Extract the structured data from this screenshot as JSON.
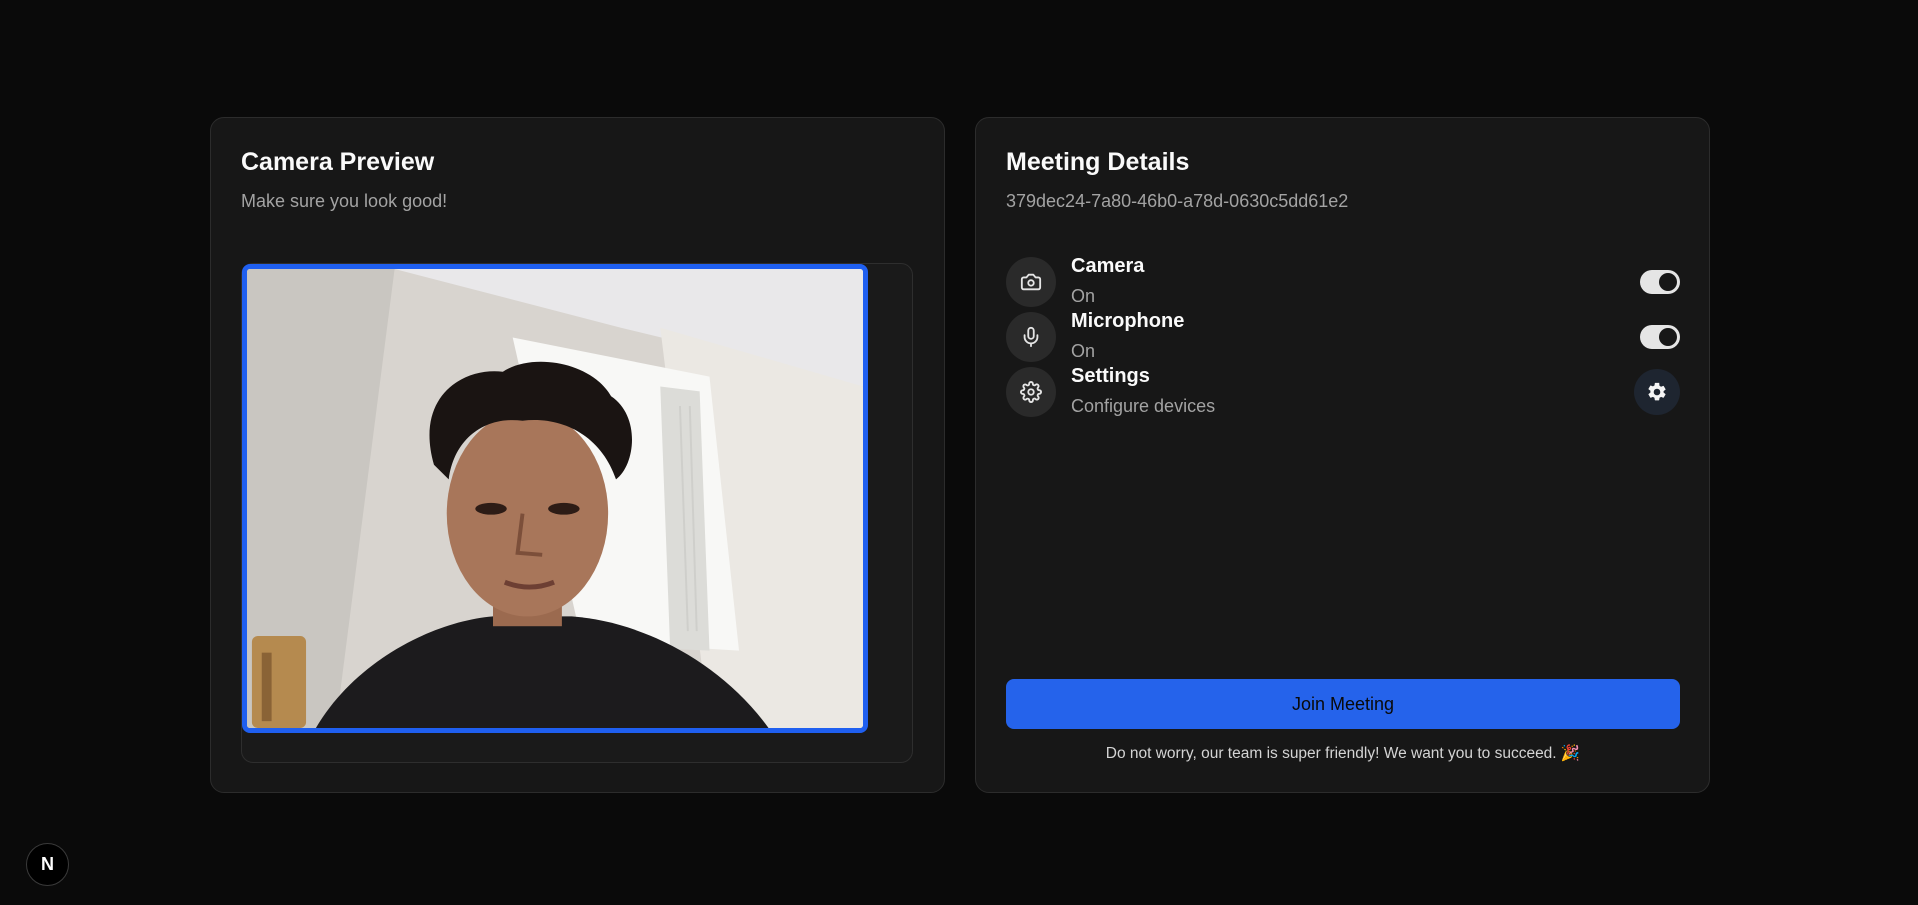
{
  "camera_preview": {
    "title": "Camera Preview",
    "subtitle": "Make sure you look good!"
  },
  "meeting_details": {
    "title": "Meeting Details",
    "meeting_id": "379dec24-7a80-46b0-a78d-0630c5dd61e2",
    "devices": [
      {
        "name": "Camera",
        "status": "On",
        "icon": "camera-icon",
        "control": "toggle",
        "enabled": true
      },
      {
        "name": "Microphone",
        "status": "On",
        "icon": "microphone-icon",
        "control": "toggle",
        "enabled": true
      },
      {
        "name": "Settings",
        "status": "Configure devices",
        "icon": "gear-icon",
        "control": "button"
      }
    ],
    "join_label": "Join Meeting",
    "footnote": "Do not worry, our team is super friendly! We want you to succeed. 🎉"
  },
  "badge": {
    "label": "N",
    "icon": "nextjs-logo"
  },
  "colors": {
    "background": "#0a0a0a",
    "card": "#171717",
    "accent": "#2563eb",
    "video_border": "#1f5ff0"
  }
}
